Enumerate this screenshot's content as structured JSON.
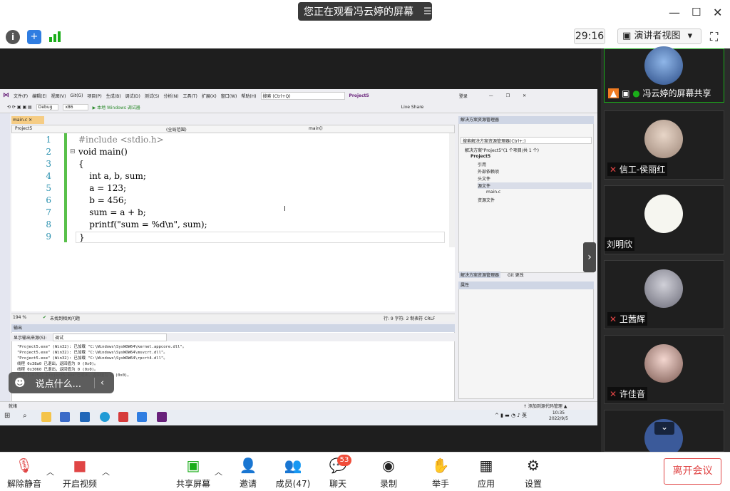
{
  "top": {
    "banner_text": "您正在观看冯云婷的屏幕",
    "banner_menu": "☰",
    "timer": "29:16",
    "view_label": "演讲者视图",
    "view_caret": "▾"
  },
  "vs": {
    "menu": [
      "文件(F)",
      "编辑(E)",
      "视图(V)",
      "Git(G)",
      "项目(P)",
      "生成(B)",
      "调试(D)",
      "测试(S)",
      "分析(N)",
      "工具(T)",
      "扩展(X)",
      "窗口(W)",
      "帮助(H)"
    ],
    "search_placeholder": "搜索 (Ctrl+Q)",
    "project_name": "Project5",
    "login": "登录",
    "config": "Debug",
    "platform": "x86",
    "run_label": "▶ 本地 Windows 调试器",
    "live_share": "Live Share",
    "file_tab": "main.c",
    "nav_project": "Project5",
    "nav_scope": "(全局范围)",
    "nav_func": "main()",
    "line_numbers": [
      "1",
      "2",
      "3",
      "4",
      "5",
      "6",
      "7",
      "8",
      "9"
    ],
    "code_lines": [
      "#include <stdio.h>",
      "void main()",
      "{",
      "    int a, b, sum;",
      "    a = 123;",
      "    b = 456;",
      "    sum = a + b;",
      "    printf(\"sum = %d\\n\", sum);",
      "}"
    ],
    "zoom": "194 %",
    "no_issues": "未找到相关问题",
    "cursor_pos": "行: 9    字符: 2    制表符    CRLF",
    "output_title": "输出",
    "output_source_label": "显示输出来源(S):",
    "output_source_value": "调试",
    "output_lines": [
      "\"Project5.exe\" (Win32): 已加载 \"C:\\Windows\\SysWOW64\\kernel.appcore.dll\"。",
      "\"Project5.exe\" (Win32): 已加载 \"C:\\Windows\\SysWOW64\\msvcrt.dll\"。",
      "\"Project5.exe\" (Win32): 已加载 \"C:\\Windows\\SysWOW64\\rpcrt4.dll\"。",
      "线程 0x38a0 已退出，返回值为 0 (0x0)。",
      "线程 0x3060 已退出，返回值为 0 (0x0)。",
      "程序\"[10752] Project5.exe\"已退出，返回值为 0 (0x0)。"
    ],
    "solution_title": "解决方案资源管理器",
    "solution_search": "搜索解决方案资源管理器(Ctrl+;)",
    "solution_items": [
      "解决方案\"Project5\"(1 个项目/共 1 个)",
      "Project5",
      "引用",
      "外部依赖项",
      "头文件",
      "源文件",
      "main.c",
      "资源文件"
    ],
    "solution_tab": "解决方案资源管理器",
    "git_tab": "Git 更改",
    "props_title": "属性",
    "status_ready": "就绪",
    "status_add_source": "↑ 添加到源代码管理 ▲",
    "tray_lang": "英",
    "clock_time": "10:35",
    "clock_date": "2022/9/5"
  },
  "chat_bubble": "说点什么...",
  "participants": [
    {
      "name": "冯云婷的屏幕共享"
    },
    {
      "name": "信工-侯丽红"
    },
    {
      "name": "刘明欣"
    },
    {
      "name": "卫茜辉"
    },
    {
      "name": "许佳音"
    }
  ],
  "bottom": {
    "mute": "解除静音",
    "video": "开启视频",
    "share": "共享屏幕",
    "invite": "邀请",
    "members": "成员(47)",
    "chat": "聊天",
    "chat_badge": "53",
    "record": "录制",
    "raise_hand": "举手",
    "apps": "应用",
    "settings": "设置",
    "leave": "离开会议"
  },
  "colors": {
    "accent_green": "#1aad19",
    "leave_red": "#e04545",
    "vs_purple": "#68217a"
  }
}
